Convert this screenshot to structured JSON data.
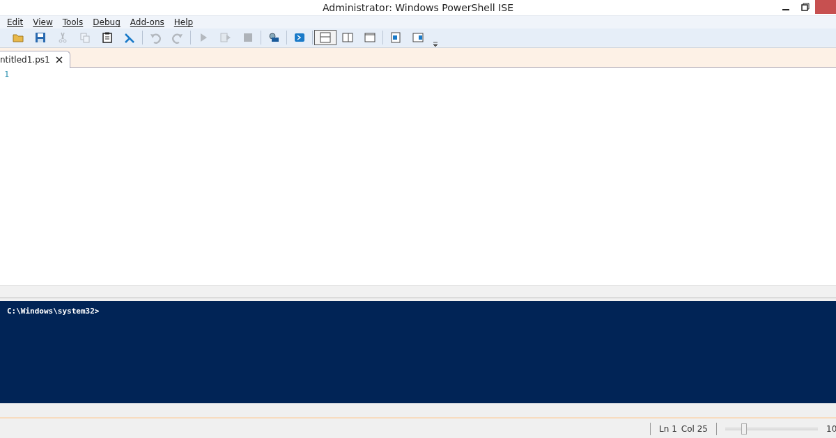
{
  "window": {
    "title": "Administrator: Windows PowerShell ISE"
  },
  "menu": [
    "Edit",
    "View",
    "Tools",
    "Debug",
    "Add-ons",
    "Help"
  ],
  "toolbar": [
    {
      "kind": "open",
      "disabled": false
    },
    {
      "kind": "save",
      "disabled": false
    },
    {
      "kind": "cut",
      "disabled": true
    },
    {
      "kind": "copy",
      "disabled": true
    },
    {
      "kind": "paste",
      "disabled": false
    },
    {
      "kind": "clear",
      "disabled": false
    },
    {
      "kind": "separator"
    },
    {
      "kind": "undo",
      "disabled": true
    },
    {
      "kind": "redo",
      "disabled": true
    },
    {
      "kind": "separator"
    },
    {
      "kind": "run",
      "disabled": true
    },
    {
      "kind": "run-selection",
      "disabled": true
    },
    {
      "kind": "stop",
      "disabled": true
    },
    {
      "kind": "separator"
    },
    {
      "kind": "remote",
      "disabled": false
    },
    {
      "kind": "separator"
    },
    {
      "kind": "console",
      "disabled": false
    },
    {
      "kind": "separator"
    },
    {
      "kind": "layout-top",
      "selected": true
    },
    {
      "kind": "layout-right",
      "selected": false
    },
    {
      "kind": "layout-max",
      "selected": false
    },
    {
      "kind": "separator"
    },
    {
      "kind": "show-script",
      "disabled": false
    },
    {
      "kind": "show-commands",
      "disabled": false
    }
  ],
  "tabs": [
    {
      "label": "ntitled1.ps1",
      "selected": true
    }
  ],
  "editor": {
    "line_numbers": [
      "1"
    ]
  },
  "console": {
    "prompt": "C:\\Windows\\system32>"
  },
  "status_bar": {
    "line": "Ln 1",
    "column": "Col 25",
    "zoom": {
      "level": 0.2
    },
    "zoom_text": "10"
  }
}
